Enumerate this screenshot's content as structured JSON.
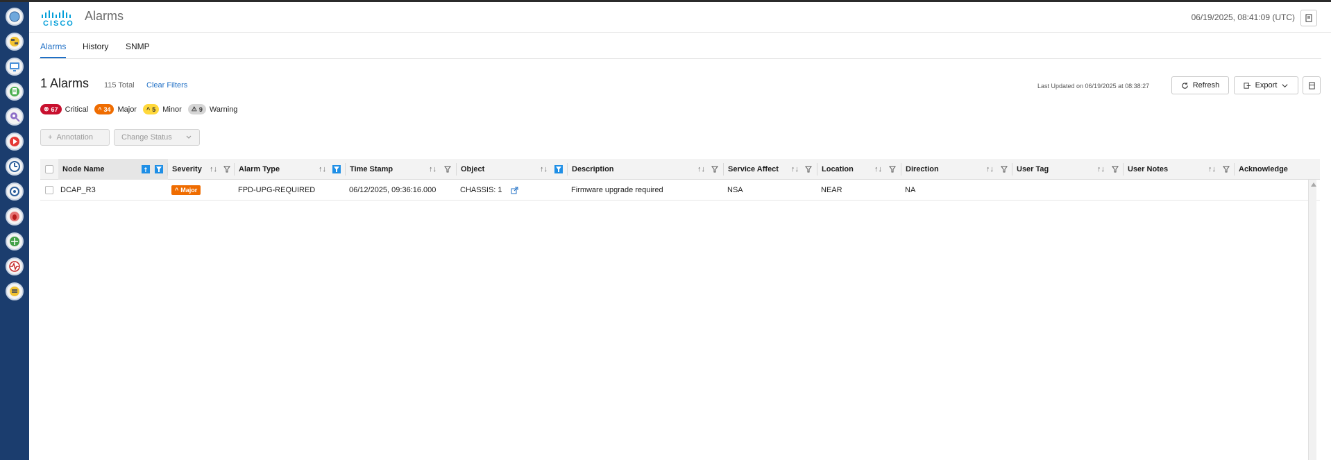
{
  "header": {
    "logo_text": "cisco",
    "title": "Alarms",
    "datetime": "06/19/2025, 08:41:09 (UTC)"
  },
  "tabs": [
    {
      "label": "Alarms",
      "active": true
    },
    {
      "label": "History",
      "active": false
    },
    {
      "label": "SNMP",
      "active": false
    }
  ],
  "summary": {
    "count_title": "1 Alarms",
    "total": "115 Total",
    "clear_filters": "Clear Filters",
    "last_updated": "Last Updated on 06/19/2025 at 08:38:27"
  },
  "toolbar": {
    "refresh_label": "Refresh",
    "export_label": "Export"
  },
  "severity_counts": [
    {
      "count": "67",
      "label": "Critical",
      "color": "#c8102e"
    },
    {
      "count": "34",
      "label": "Major",
      "color": "#ef6c00"
    },
    {
      "count": "5",
      "label": "Minor",
      "color": "#ffd83b"
    },
    {
      "count": "9",
      "label": "Warning",
      "color": "#d5d5d5"
    }
  ],
  "actions": {
    "annotation_label": "Annotation",
    "change_status_label": "Change Status"
  },
  "table": {
    "columns": [
      "Node Name",
      "Severity",
      "Alarm Type",
      "Time Stamp",
      "Object",
      "Description",
      "Service Affect",
      "Location",
      "Direction",
      "User Tag",
      "User Notes",
      "Acknowledge"
    ],
    "rows": [
      {
        "node_name": "DCAP_R3",
        "severity": "Major",
        "alarm_type": "FPD-UPG-REQUIRED",
        "time_stamp": "06/12/2025, 09:36:16.000",
        "object": "CHASSIS: 1",
        "description": "Firmware upgrade required",
        "service_affect": "NSA",
        "location": "NEAR",
        "direction": "NA",
        "user_tag": "",
        "user_notes": "",
        "acknowledge": ""
      }
    ]
  },
  "colors": {
    "accent": "#1f6fc5",
    "sidebar": "#1b3d6e",
    "filter_active": "#1f8fe6"
  },
  "sidebar_icons": [
    "globe-icon",
    "network-devices-icon",
    "monitor-icon",
    "document-icon",
    "search-node-icon",
    "play-icon",
    "gauge-icon",
    "settings-gear-icon",
    "bug-icon",
    "topology-icon",
    "pulse-icon",
    "database-icon"
  ]
}
